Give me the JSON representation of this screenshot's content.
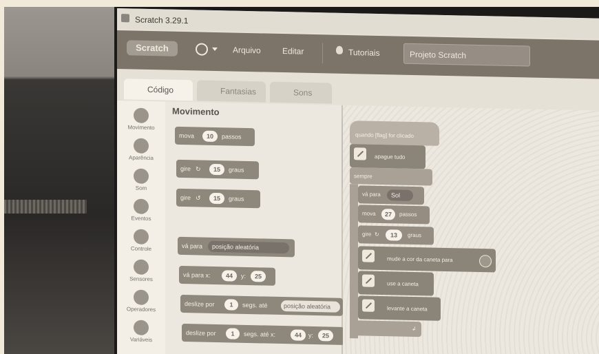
{
  "window": {
    "title": "Scratch 3.29.1"
  },
  "menubar": {
    "logo": "Scratch",
    "file": "Arquivo",
    "edit": "Editar",
    "tutorials": "Tutoriais",
    "project_title": "Projeto Scratch"
  },
  "tabs": {
    "code": "Código",
    "costumes": "Fantasias",
    "sounds": "Sons"
  },
  "categories": [
    "Movimento",
    "Aparência",
    "Som",
    "Eventos",
    "Controle",
    "Sensores",
    "Operadores",
    "Variáveis"
  ],
  "palette": {
    "title": "Movimento",
    "move": {
      "label": "mova",
      "value": "10",
      "suffix": "passos"
    },
    "turn_right": {
      "label": "gire",
      "value": "15",
      "suffix": "graus"
    },
    "turn_left": {
      "label": "gire",
      "value": "15",
      "suffix": "graus"
    },
    "goto": {
      "label": "vá para",
      "target": "posição aleatória"
    },
    "goto_xy": {
      "label": "vá para x:",
      "x": "44",
      "ylabel": "y:",
      "y": "25"
    },
    "glide": {
      "label": "deslize por",
      "secs": "1",
      "mid": "segs. até",
      "target": "posição aleatória"
    },
    "glide_xy": {
      "label": "deslize por",
      "secs": "1",
      "mid": "segs. até x:",
      "x": "44",
      "ylabel": "y:",
      "y": "25"
    }
  },
  "script": {
    "hat": "quando [flag] for clicado",
    "clear": "apague tudo",
    "forever": "sempre",
    "goto": {
      "label": "vá para",
      "target": "Sol"
    },
    "move": {
      "label": "mova",
      "value": "27",
      "suffix": "passos"
    },
    "turn": {
      "label": "gire",
      "value": "13",
      "suffix": "graus"
    },
    "set_color": "mude a cor da caneta para",
    "pen_down": "use a caneta",
    "pen_up": "levante a caneta"
  }
}
